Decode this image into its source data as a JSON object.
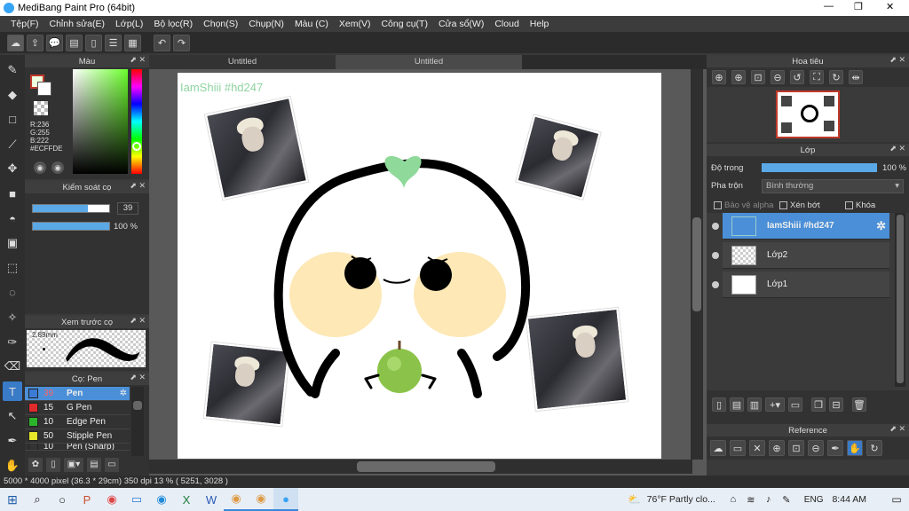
{
  "window": {
    "title": "MediBang Paint Pro (64bit)",
    "controls": [
      "—",
      "❐",
      "✕"
    ]
  },
  "menu": [
    "Tệp(F)",
    "Chỉnh sửa(E)",
    "Lớp(L)",
    "Bộ lọc(R)",
    "Chọn(S)",
    "Chụp(N)",
    "Màu (C)",
    "Xem(V)",
    "Công cụ(T)",
    "Cửa sổ(W)",
    "Cloud",
    "Help"
  ],
  "tabs": [
    "Untitled",
    "Untitled"
  ],
  "canvas": {
    "watermark": "IamShiii #hd247"
  },
  "color_panel": {
    "title": "Màu",
    "r": "R:236",
    "g": "G:255",
    "b": "B:222",
    "hex": "#ECFFDE"
  },
  "brush_control": {
    "title": "Kiểm soát cọ",
    "size": "39",
    "opacity": "100 %",
    "size_fill": 0.72,
    "opacity_fill": 1.0
  },
  "brush_preview": {
    "title": "Xem trước cọ",
    "size_label": "2.89mm"
  },
  "brush_list": {
    "title": "Cọ: Pen",
    "items": [
      {
        "num": "39",
        "name": "Pen",
        "color": "#3b7bd6",
        "selected": true
      },
      {
        "num": "15",
        "name": "G Pen",
        "color": "#e02b2b"
      },
      {
        "num": "10",
        "name": "Edge Pen",
        "color": "#2bb52b"
      },
      {
        "num": "50",
        "name": "Stipple Pen",
        "color": "#e6e62b"
      },
      {
        "num": "10",
        "name": "Pen (Sharp)",
        "color": "#333333"
      }
    ]
  },
  "navigator": {
    "title": "Hoa tiêu"
  },
  "layers": {
    "title": "Lớp",
    "opacity_label": "Độ trong",
    "opacity_value": "100 %",
    "blend_label": "Pha trộn",
    "blend_value": "Bình thường",
    "protect_alpha": "Bảo vệ alpha",
    "clipping": "Xén bớt",
    "lock": "Khóa",
    "items": [
      {
        "name": "IamShiii #hd247",
        "selected": true
      },
      {
        "name": "Lớp2"
      },
      {
        "name": "Lớp1"
      }
    ]
  },
  "reference": {
    "title": "Reference"
  },
  "status": "5000 * 4000 pixel  (36.3 * 29cm)  350 dpi  13 %  ( 5251, 3028 )",
  "taskbar": {
    "weather": "76°F  Partly clo...",
    "lang": "ENG",
    "time": "8:44 AM"
  }
}
